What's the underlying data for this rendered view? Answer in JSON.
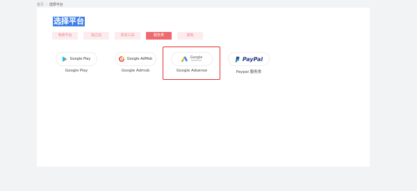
{
  "breadcrumb": {
    "home": "首页",
    "separator": "/",
    "current": "选择平台"
  },
  "page": {
    "title": "选择平台"
  },
  "tabs": [
    {
      "label": "电商平台",
      "active": false
    },
    {
      "label": "独立站",
      "active": false
    },
    {
      "label": "发货工具",
      "active": false
    },
    {
      "label": "服务类",
      "active": true
    },
    {
      "label": "其他",
      "active": false
    }
  ],
  "platforms": [
    {
      "logo_text": "Google Play",
      "label": "Google Play",
      "icon": "google-play-icon",
      "selected": false
    },
    {
      "logo_text": "Google AdMob",
      "label": "Google Admob",
      "icon": "google-admob-icon",
      "selected": false
    },
    {
      "logo_text": "Google",
      "logo_subtext": "AdSense",
      "label": "Google Adsense",
      "icon": "google-adsense-icon",
      "selected": true
    },
    {
      "logo_text": "PayPal",
      "label": "Paypal 服务类",
      "icon": "paypal-icon",
      "selected": false
    }
  ],
  "colors": {
    "accent": "#ef6a70",
    "tab_bg": "#fdecee",
    "title_highlight": "#3e80e8",
    "selected_border": "#e22a2a",
    "paypal_dark": "#253b80",
    "paypal_light": "#179bd7"
  }
}
